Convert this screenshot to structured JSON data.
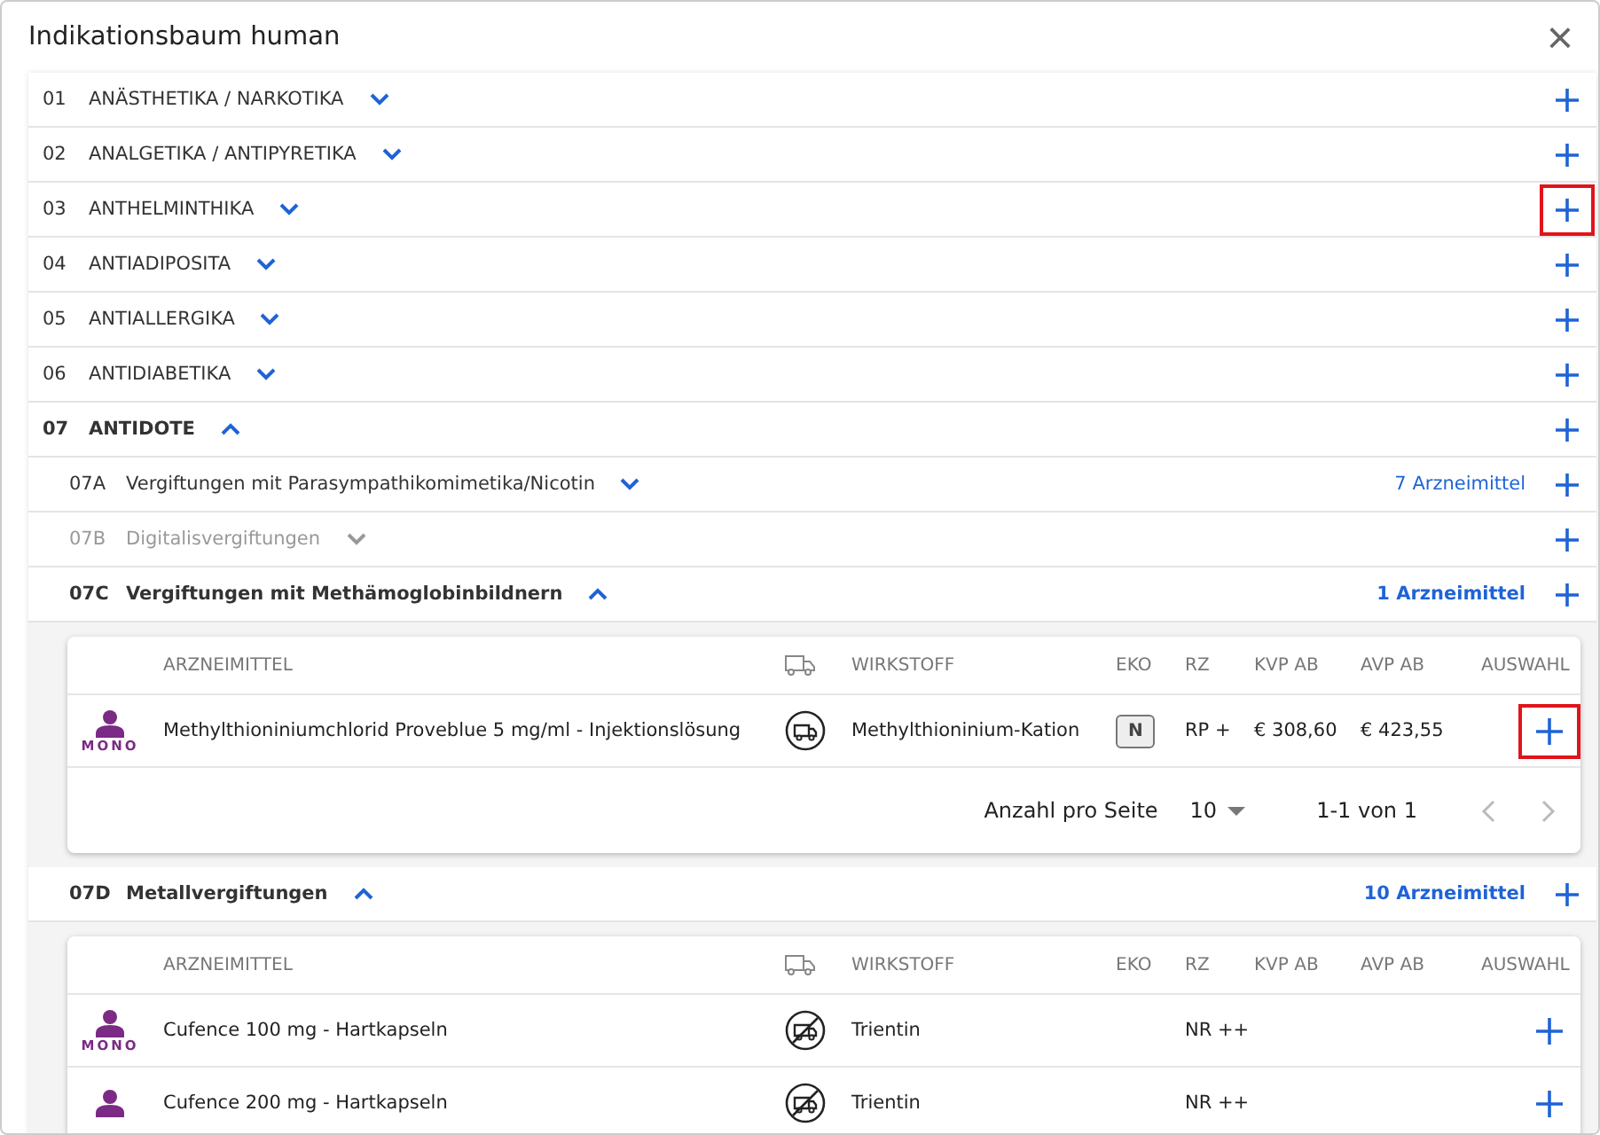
{
  "dialog": {
    "title": "Indikationsbaum human",
    "close": "×"
  },
  "categories": [
    {
      "code": "01",
      "label": "ANÄSTHETIKA / NARKOTIKA",
      "expanded": false,
      "highlighted": false
    },
    {
      "code": "02",
      "label": "ANALGETIKA / ANTIPYRETIKA",
      "expanded": false,
      "highlighted": false
    },
    {
      "code": "03",
      "label": "ANTHELMINTHIKA",
      "expanded": false,
      "highlighted": true
    },
    {
      "code": "04",
      "label": "ANTIADIPOSITA",
      "expanded": false,
      "highlighted": false
    },
    {
      "code": "05",
      "label": "ANTIALLERGIKA",
      "expanded": false,
      "highlighted": false
    },
    {
      "code": "06",
      "label": "ANTIDIABETIKA",
      "expanded": false,
      "highlighted": false
    },
    {
      "code": "07",
      "label": "ANTIDOTE",
      "expanded": true,
      "highlighted": false,
      "children": [
        {
          "code": "07A",
          "label": "Vergiftungen mit Parasympathikomimetika/Nicotin",
          "expanded": false,
          "disabled": false,
          "highlighted": false,
          "count": "7 Arzneimittel"
        },
        {
          "code": "07B",
          "label": "Digitalisvergiftungen",
          "expanded": false,
          "disabled": true,
          "highlighted": false
        },
        {
          "code": "07C",
          "label": "Vergiftungen mit Methämoglobinbildnern",
          "expanded": true,
          "disabled": false,
          "highlighted": false,
          "count": "1 Arzneimittel",
          "table": {
            "columns": [
              "ARZNEIMITTEL",
              "WIRKSTOFF",
              "EKO",
              "RZ",
              "KVP AB",
              "AVP AB",
              "AUSWAHL"
            ],
            "rows": [
              {
                "badge": "MONO",
                "name": "Methylthioniniumchlorid Proveblue 5 mg/ml - Injektionslösung",
                "deliverable": true,
                "substance": "Methylthioninium-Kation",
                "eko": "N",
                "rz": "RP +",
                "kvp": "€ 308,60",
                "avp": "€ 423,55",
                "highlighted": true
              }
            ],
            "pagination": {
              "label": "Anzahl pro Seite",
              "page_size": "10",
              "range": "1-1 von 1",
              "prev_disabled": true,
              "next_disabled": true
            }
          }
        },
        {
          "code": "07D",
          "label": "Metallvergiftungen",
          "expanded": true,
          "disabled": false,
          "highlighted": false,
          "count": "10 Arzneimittel",
          "table": {
            "columns": [
              "ARZNEIMITTEL",
              "WIRKSTOFF",
              "EKO",
              "RZ",
              "KVP AB",
              "AVP AB",
              "AUSWAHL"
            ],
            "rows": [
              {
                "badge": "MONO",
                "name": "Cufence 100 mg - Hartkapseln",
                "deliverable": false,
                "substance": "Trientin",
                "rz": "NR ++",
                "highlighted": false
              },
              {
                "name": "Cufence 200 mg - Hartkapseln",
                "deliverable": false,
                "substance": "Trientin",
                "rz": "NR ++",
                "highlighted": false
              }
            ]
          }
        }
      ]
    }
  ]
}
